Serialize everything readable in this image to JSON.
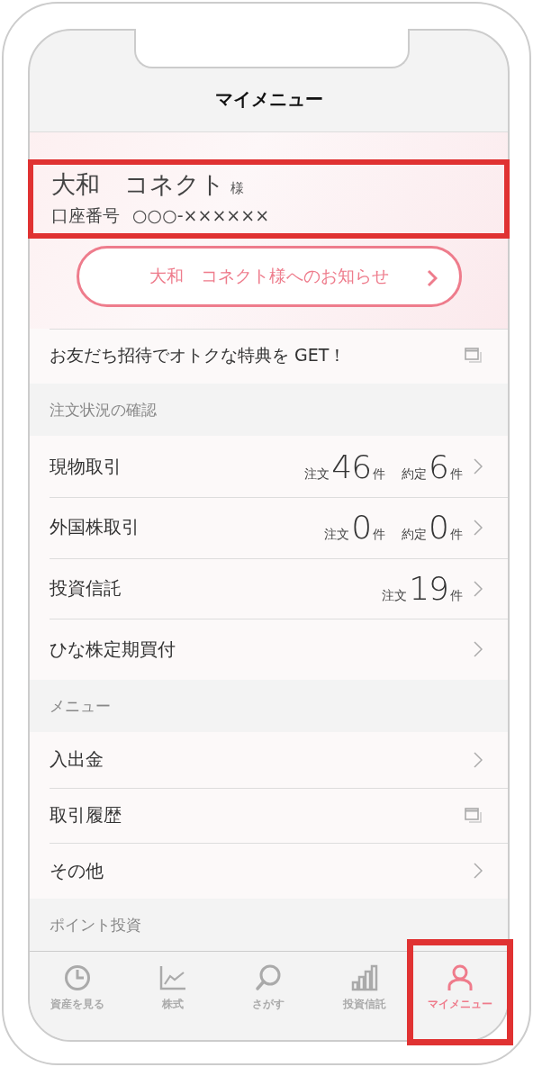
{
  "header": {
    "title": "マイメニュー"
  },
  "account": {
    "name": "大和　コネクト",
    "honorific": "様",
    "number_label": "口座番号",
    "number": "○○○-××××××",
    "highlighted": true
  },
  "notice_button": {
    "label": "大和　コネクト様へのお知らせ"
  },
  "promo": {
    "label": "お友だち招待でオトクな特典を GET！",
    "kind": "external"
  },
  "sections": [
    {
      "title": "注文状況の確認",
      "rows": [
        {
          "label": "現物取引",
          "kind": "chevron",
          "counts": [
            {
              "label": "注文",
              "value": "46",
              "unit": "件"
            },
            {
              "label": "約定",
              "value": "6",
              "unit": "件"
            }
          ]
        },
        {
          "label": "外国株取引",
          "kind": "chevron",
          "counts": [
            {
              "label": "注文",
              "value": "0",
              "unit": "件"
            },
            {
              "label": "約定",
              "value": "0",
              "unit": "件"
            }
          ]
        },
        {
          "label": "投資信託",
          "kind": "chevron",
          "counts": [
            {
              "label": "注文",
              "value": "19",
              "unit": "件"
            }
          ]
        },
        {
          "label": "ひな株定期買付",
          "kind": "chevron"
        }
      ]
    },
    {
      "title": "メニュー",
      "rows": [
        {
          "label": "入出金",
          "kind": "chevron"
        },
        {
          "label": "取引履歴",
          "kind": "external"
        },
        {
          "label": "その他",
          "kind": "chevron"
        }
      ]
    },
    {
      "title": "ポイント投資"
    }
  ],
  "tabs": [
    {
      "label": "資産を見る",
      "kind": "pie",
      "selected": false,
      "highlighted": false
    },
    {
      "label": "株式",
      "kind": "line",
      "selected": false,
      "highlighted": false
    },
    {
      "label": "さがす",
      "kind": "search",
      "selected": false,
      "highlighted": false
    },
    {
      "label": "投資信託",
      "kind": "bars",
      "selected": false,
      "highlighted": false
    },
    {
      "label": "マイメニュー",
      "kind": "person",
      "selected": true,
      "highlighted": true
    }
  ]
}
